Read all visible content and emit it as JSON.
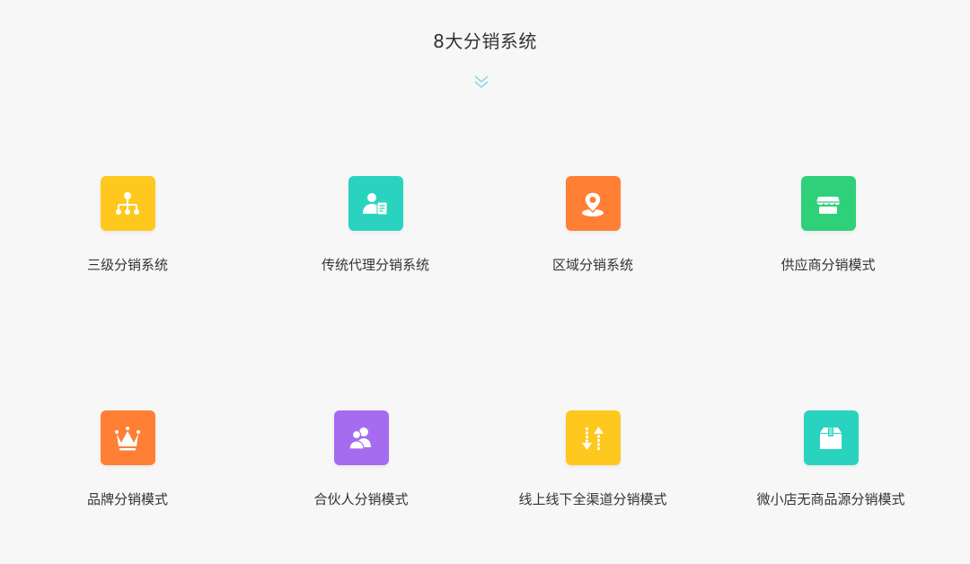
{
  "section": {
    "title": "8大分销系统",
    "chevron_icon": "double-chevron-down-icon",
    "chevron_color": "#7fd3e8"
  },
  "features": [
    {
      "label": "三级分销系统",
      "icon": "hierarchy-icon",
      "color": "#ffc81e"
    },
    {
      "label": "传统代理分销系统",
      "icon": "agent-document-icon",
      "color": "#2ad3c0"
    },
    {
      "label": "区域分销系统",
      "icon": "location-pin-icon",
      "color": "#ff7f35"
    },
    {
      "label": "供应商分销模式",
      "icon": "store-icon",
      "color": "#2fd07a"
    },
    {
      "label": "品牌分销模式",
      "icon": "crown-icon",
      "color": "#ff7f35"
    },
    {
      "label": "合伙人分销模式",
      "icon": "partners-icon",
      "color": "#a56cf0"
    },
    {
      "label": "线上线下全渠道分销模式",
      "icon": "up-down-arrows-icon",
      "color": "#ffc81e"
    },
    {
      "label": "微小店无商品源分销模式",
      "icon": "box-icon",
      "color": "#2ad3c0"
    }
  ]
}
